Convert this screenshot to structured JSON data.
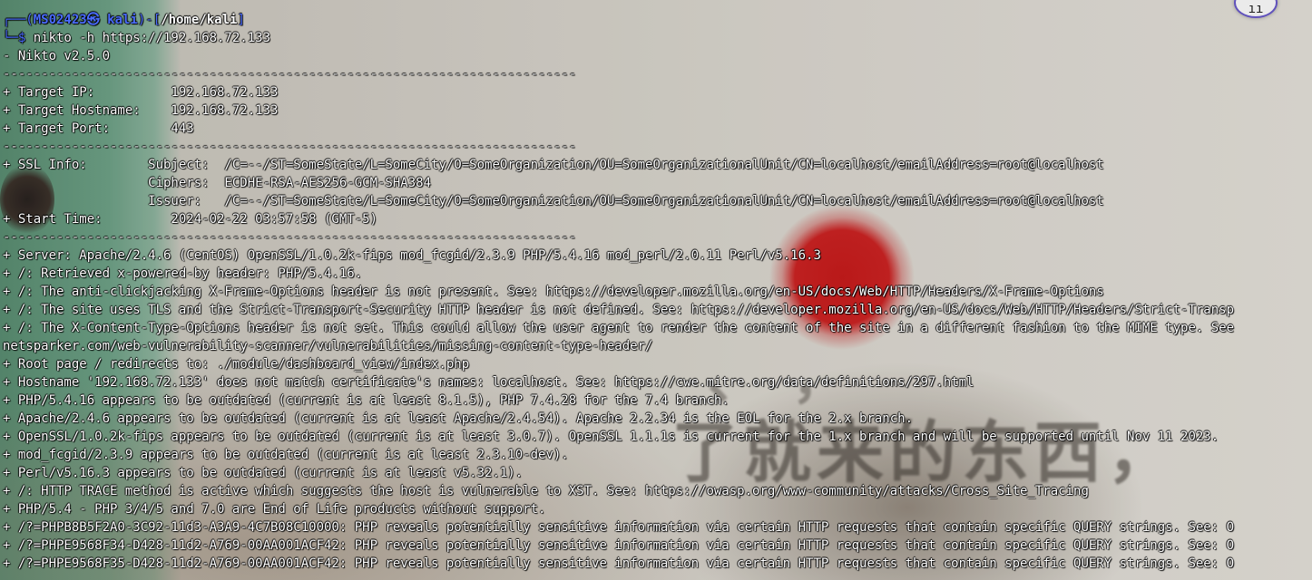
{
  "prompt": {
    "corner_top": "┌──(",
    "user": "MS02423㉿ kali",
    "mid": ")-[",
    "dir": "/home/kali",
    "end": "]",
    "corner_bottom": "└─$ ",
    "command": "nikto -h https://192.168.72.133"
  },
  "output": [
    "- Nikto v2.5.0",
    "---------------------------------------------------------------------------",
    "+ Target IP:          192.168.72.133",
    "+ Target Hostname:    192.168.72.133",
    "+ Target Port:        443",
    "---------------------------------------------------------------------------",
    "+ SSL Info:        Subject:  /C=--/ST=SomeState/L=SomeCity/O=SomeOrganization/OU=SomeOrganizationalUnit/CN=localhost/emailAddress=root@localhost",
    "                   Ciphers:  ECDHE-RSA-AES256-GCM-SHA384",
    "                   Issuer:   /C=--/ST=SomeState/L=SomeCity/O=SomeOrganization/OU=SomeOrganizationalUnit/CN=localhost/emailAddress=root@localhost",
    "+ Start Time:         2024-02-22 03:57:58 (GMT-5)",
    "---------------------------------------------------------------------------",
    "+ Server: Apache/2.4.6 (CentOS) OpenSSL/1.0.2k-fips mod_fcgid/2.3.9 PHP/5.4.16 mod_perl/2.0.11 Perl/v5.16.3",
    "+ /: Retrieved x-powered-by header: PHP/5.4.16.",
    "+ /: The anti-clickjacking X-Frame-Options header is not present. See: https://developer.mozilla.org/en-US/docs/Web/HTTP/Headers/X-Frame-Options",
    "+ /: The site uses TLS and the Strict-Transport-Security HTTP header is not defined. See: https://developer.mozilla.org/en-US/docs/Web/HTTP/Headers/Strict-Transp",
    "+ /: The X-Content-Type-Options header is not set. This could allow the user agent to render the content of the site in a different fashion to the MIME type. See",
    "netsparker.com/web-vulnerability-scanner/vulnerabilities/missing-content-type-header/",
    "+ Root page / redirects to: ./module/dashboard_view/index.php",
    "+ Hostname '192.168.72.133' does not match certificate's names: localhost. See: https://cwe.mitre.org/data/definitions/297.html",
    "+ PHP/5.4.16 appears to be outdated (current is at least 8.1.5), PHP 7.4.28 for the 7.4 branch.",
    "+ Apache/2.4.6 appears to be outdated (current is at least Apache/2.4.54). Apache 2.2.34 is the EOL for the 2.x branch.",
    "+ OpenSSL/1.0.2k-fips appears to be outdated (current is at least 3.0.7). OpenSSL 1.1.1s is current for the 1.x branch and will be supported until Nov 11 2023.",
    "+ mod_fcgid/2.3.9 appears to be outdated (current is at least 2.3.10-dev).",
    "+ Perl/v5.16.3 appears to be outdated (current is at least v5.32.1).",
    "+ /: HTTP TRACE method is active which suggests the host is vulnerable to XST. See: https://owasp.org/www-community/attacks/Cross_Site_Tracing",
    "+ PHP/5.4 - PHP 3/4/5 and 7.0 are End of Life products without support.",
    "+ /?=PHPB8B5F2A0-3C92-11d3-A3A9-4C7B08C10000: PHP reveals potentially sensitive information via certain HTTP requests that contain specific QUERY strings. See: O",
    "+ /?=PHPE9568F34-D428-11d2-A769-00AA001ACF42: PHP reveals potentially sensitive information via certain HTTP requests that contain specific QUERY strings. See: O",
    "+ /?=PHPE9568F35-D428-11d2-A769-00AA001ACF42: PHP reveals potentially sensitive information via certain HTTP requests that contain specific QUERY strings. See: O"
  ]
}
